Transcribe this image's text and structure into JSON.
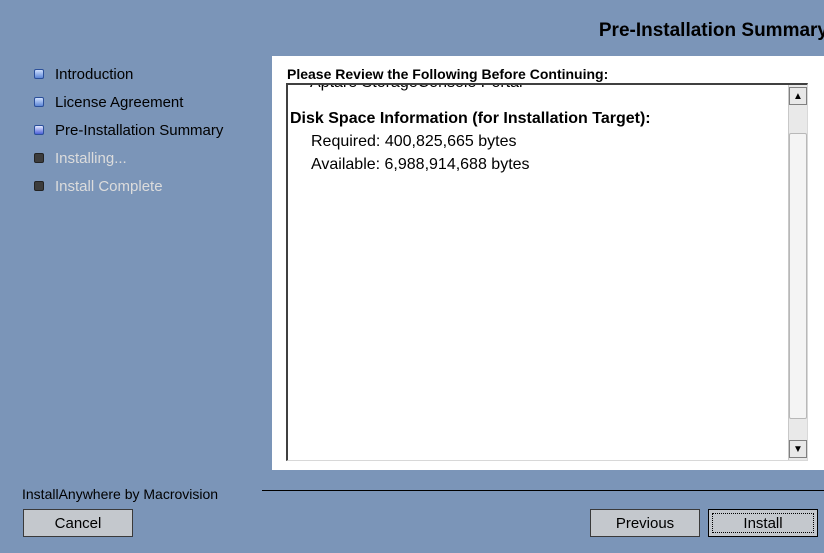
{
  "header": {
    "title": "Pre-Installation Summary"
  },
  "steps": [
    {
      "label": "Introduction",
      "state": "done"
    },
    {
      "label": "License Agreement",
      "state": "done"
    },
    {
      "label": "Pre-Installation Summary",
      "state": "current"
    },
    {
      "label": "Installing...",
      "state": "pending"
    },
    {
      "label": "Install Complete",
      "state": "pending"
    }
  ],
  "panel": {
    "heading": "Please Review the Following Before Continuing:",
    "clipped_line": "Aptare StorageConsole Portal",
    "section_title": "Disk Space Information (for Installation Target):",
    "required": "Required: 400,825,665 bytes",
    "available": "Available: 6,988,914,688 bytes"
  },
  "footer": {
    "vendor": "InstallAnywhere by Macrovision",
    "cancel_label": "Cancel",
    "previous_label": "Previous",
    "install_label": "Install"
  },
  "icons": {
    "scroll_up": "up-arrow-icon",
    "scroll_down": "down-arrow-icon",
    "step_bullet": "square-bullet-icon"
  },
  "colors": {
    "background": "#7b95b8",
    "panel": "#ffffff",
    "inactive_text": "#dcdcdc"
  }
}
